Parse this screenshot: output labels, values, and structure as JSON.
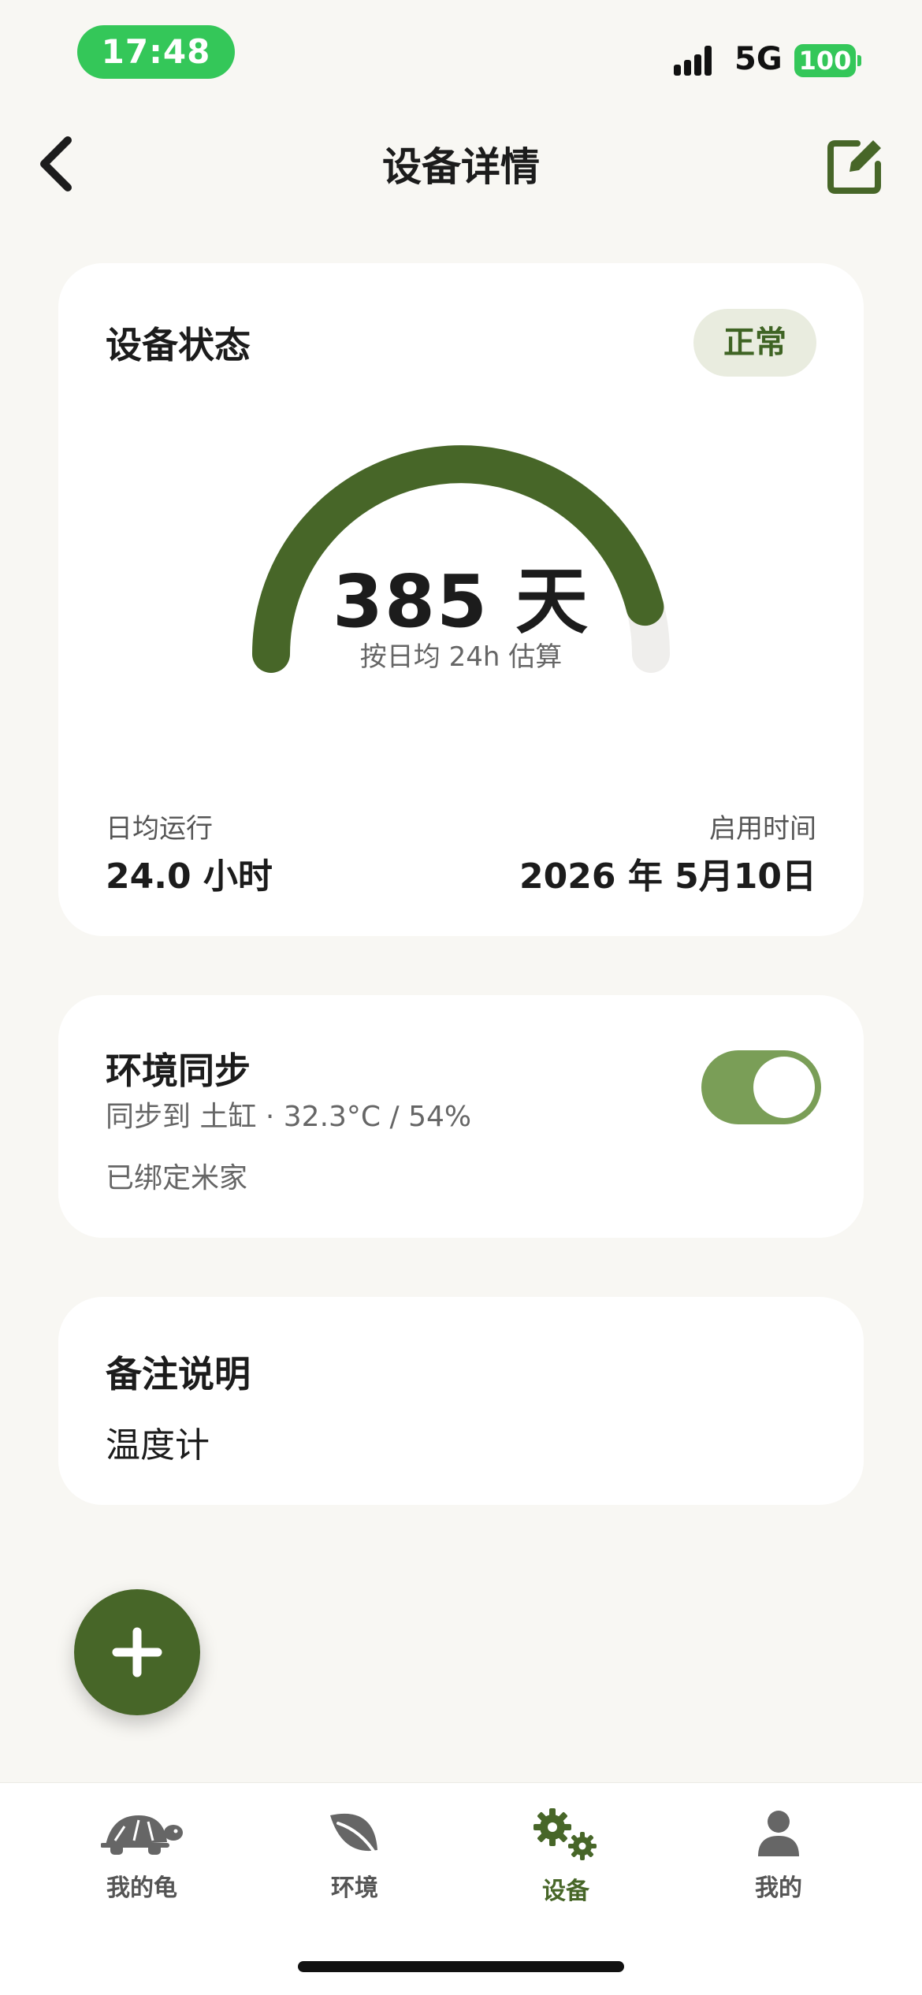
{
  "status_bar": {
    "time": "17:48",
    "network": "5G",
    "battery": "100"
  },
  "header": {
    "title": "设备详情",
    "back_icon": "chevron-left-icon",
    "edit_icon": "edit-icon"
  },
  "device_status": {
    "title": "设备状态",
    "badge": "正常",
    "gauge_value": "385 天",
    "gauge_note": "按日均 24h 估算",
    "gauge_fraction": 0.92,
    "daily_run_label": "日均运行",
    "daily_run_value": "24.0 小时",
    "start_label": "启用时间",
    "start_value": "2026 年 5月10日"
  },
  "env_sync": {
    "title": "环境同步",
    "subtitle": "同步到 土缸 · 32.3°C / 54%",
    "bound": "已绑定米家",
    "toggle_on": true
  },
  "notes": {
    "title": "备注说明",
    "text": "温度计"
  },
  "fab": {
    "icon": "plus-icon"
  },
  "tabs": [
    {
      "label": "我的龟",
      "icon": "turtle-icon",
      "active": false
    },
    {
      "label": "环境",
      "icon": "leaf-icon",
      "active": false
    },
    {
      "label": "设备",
      "icon": "gears-icon",
      "active": true
    },
    {
      "label": "我的",
      "icon": "person-icon",
      "active": false
    }
  ],
  "colors": {
    "accent": "#476628",
    "badge_bg": "#e9ecdf",
    "toggle": "#7a9e57",
    "status_green": "#34c759",
    "background": "#f8f7f3"
  }
}
